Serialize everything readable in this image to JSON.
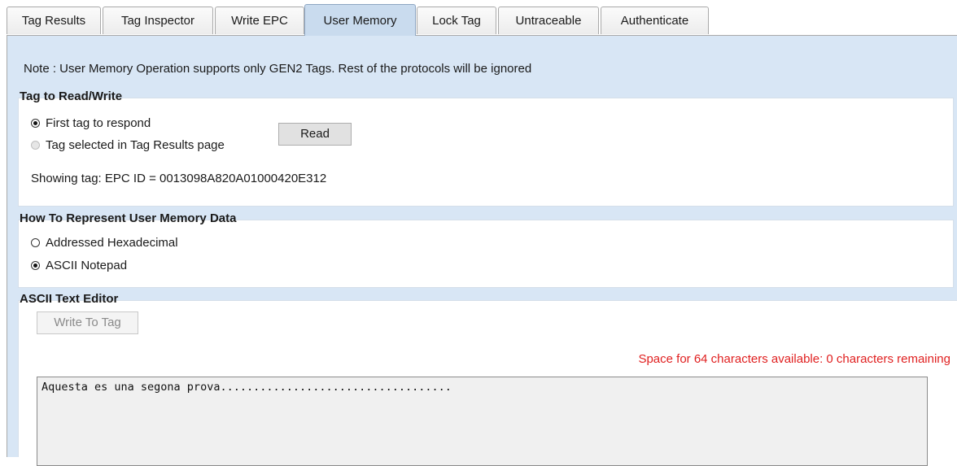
{
  "tabs": [
    {
      "label": "Tag Results"
    },
    {
      "label": "Tag Inspector"
    },
    {
      "label": "Write EPC"
    },
    {
      "label": "User Memory"
    },
    {
      "label": "Lock Tag"
    },
    {
      "label": "Untraceable"
    },
    {
      "label": "Authenticate"
    }
  ],
  "active_tab": "User Memory",
  "note": "Note : User Memory Operation supports only GEN2 Tags. Rest of the protocols will be ignored",
  "tag_group": {
    "title": "Tag to Read/Write",
    "option_first": "First tag to respond",
    "option_selected": "Tag selected in Tag Results page",
    "read_label": "Read",
    "showing": "Showing tag: EPC ID = 0013098A820A01000420E312"
  },
  "represent_group": {
    "title": "How To Represent User Memory Data",
    "option_hex": "Addressed Hexadecimal",
    "option_ascii": "ASCII Notepad"
  },
  "editor": {
    "title": "ASCII Text Editor",
    "write_label": "Write To Tag",
    "remaining": "Space for 64 characters available: 0 characters remaining",
    "text": "Aquesta es una segona prova..................................."
  },
  "colors": {
    "panel_bg": "#d8e6f5",
    "active_tab": "#c9dbee",
    "warning": "#e02020"
  }
}
